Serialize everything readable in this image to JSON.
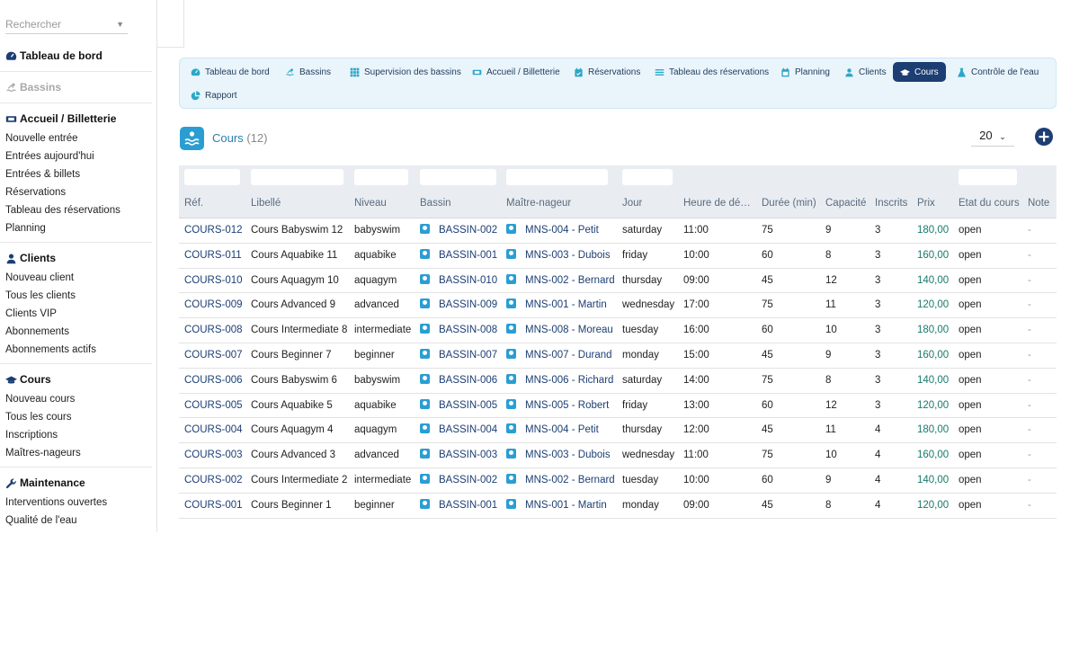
{
  "search": {
    "placeholder": "Rechercher"
  },
  "sidebar": {
    "sections": [
      {
        "title": "Tableau de bord",
        "icon": "dashboard-icon",
        "disabled": false,
        "items": []
      },
      {
        "title": "Bassins",
        "icon": "swimmer-icon",
        "disabled": true,
        "items": []
      },
      {
        "title": "Accueil / Billetterie",
        "icon": "ticket-icon",
        "disabled": false,
        "items": [
          "Nouvelle entrée",
          "Entrées aujourd'hui",
          "Entrées & billets",
          "Réservations",
          "Tableau des réservations",
          "Planning"
        ]
      },
      {
        "title": "Clients",
        "icon": "user-icon",
        "disabled": false,
        "items": [
          "Nouveau client",
          "Tous les clients",
          "Clients VIP",
          "Abonnements",
          "Abonnements actifs"
        ]
      },
      {
        "title": "Cours",
        "icon": "graduation-cap-icon",
        "disabled": false,
        "items": [
          "Nouveau cours",
          "Tous les cours",
          "Inscriptions",
          "Maîtres-nageurs"
        ]
      },
      {
        "title": "Maintenance",
        "icon": "wrench-icon",
        "disabled": false,
        "items": [
          "Interventions ouvertes",
          "Qualité de l'eau"
        ]
      }
    ]
  },
  "tabs": [
    {
      "label": "Tableau de bord",
      "icon": "dashboard-icon",
      "active": false
    },
    {
      "label": "Bassins",
      "icon": "swimmer-icon",
      "active": false
    },
    {
      "label": "Supervision des bassins",
      "icon": "grid-icon",
      "active": false
    },
    {
      "label": "Accueil / Billetterie",
      "icon": "ticket-icon",
      "active": false
    },
    {
      "label": "Réservations",
      "icon": "calendar-check-icon",
      "active": false
    },
    {
      "label": "Tableau des réservations",
      "icon": "list-icon",
      "active": false
    },
    {
      "label": "Planning",
      "icon": "calendar-icon",
      "active": false
    },
    {
      "label": "Clients",
      "icon": "user-icon",
      "active": false
    },
    {
      "label": "Cours",
      "icon": "graduation-cap-icon",
      "active": true
    },
    {
      "label": "Contrôle de l'eau",
      "icon": "flask-icon",
      "active": false
    },
    {
      "label": "Rapport",
      "icon": "pie-chart-icon",
      "active": false
    }
  ],
  "page": {
    "title": "Cours",
    "count": "(12)",
    "per_page": "20"
  },
  "table": {
    "columns": [
      "Réf.",
      "Libellé",
      "Niveau",
      "Bassin",
      "Maître-nageur",
      "Jour",
      "Heure de dé…",
      "Durée (min)",
      "Capacité",
      "Inscrits",
      "Prix",
      "État du cours",
      "Note"
    ],
    "rows": [
      [
        "COURS-012",
        "Cours Babyswim 12",
        "babyswim",
        "BASSIN-002",
        "MNS-004 - Petit",
        "saturday",
        "11:00",
        "75",
        "9",
        "3",
        "180,00",
        "open",
        "-"
      ],
      [
        "COURS-011",
        "Cours Aquabike 11",
        "aquabike",
        "BASSIN-001",
        "MNS-003 - Dubois",
        "friday",
        "10:00",
        "60",
        "8",
        "3",
        "160,00",
        "open",
        "-"
      ],
      [
        "COURS-010",
        "Cours Aquagym 10",
        "aquagym",
        "BASSIN-010",
        "MNS-002 - Bernard",
        "thursday",
        "09:00",
        "45",
        "12",
        "3",
        "140,00",
        "open",
        "-"
      ],
      [
        "COURS-009",
        "Cours Advanced 9",
        "advanced",
        "BASSIN-009",
        "MNS-001 - Martin",
        "wednesday",
        "17:00",
        "75",
        "11",
        "3",
        "120,00",
        "open",
        "-"
      ],
      [
        "COURS-008",
        "Cours Intermediate 8",
        "intermediate",
        "BASSIN-008",
        "MNS-008 - Moreau",
        "tuesday",
        "16:00",
        "60",
        "10",
        "3",
        "180,00",
        "open",
        "-"
      ],
      [
        "COURS-007",
        "Cours Beginner 7",
        "beginner",
        "BASSIN-007",
        "MNS-007 - Durand",
        "monday",
        "15:00",
        "45",
        "9",
        "3",
        "160,00",
        "open",
        "-"
      ],
      [
        "COURS-006",
        "Cours Babyswim 6",
        "babyswim",
        "BASSIN-006",
        "MNS-006 - Richard",
        "saturday",
        "14:00",
        "75",
        "8",
        "3",
        "140,00",
        "open",
        "-"
      ],
      [
        "COURS-005",
        "Cours Aquabike 5",
        "aquabike",
        "BASSIN-005",
        "MNS-005 - Robert",
        "friday",
        "13:00",
        "60",
        "12",
        "3",
        "120,00",
        "open",
        "-"
      ],
      [
        "COURS-004",
        "Cours Aquagym 4",
        "aquagym",
        "BASSIN-004",
        "MNS-004 - Petit",
        "thursday",
        "12:00",
        "45",
        "11",
        "4",
        "180,00",
        "open",
        "-"
      ],
      [
        "COURS-003",
        "Cours Advanced 3",
        "advanced",
        "BASSIN-003",
        "MNS-003 - Dubois",
        "wednesday",
        "11:00",
        "75",
        "10",
        "4",
        "160,00",
        "open",
        "-"
      ],
      [
        "COURS-002",
        "Cours Intermediate 2",
        "intermediate",
        "BASSIN-002",
        "MNS-002 - Bernard",
        "tuesday",
        "10:00",
        "60",
        "9",
        "4",
        "140,00",
        "open",
        "-"
      ],
      [
        "COURS-001",
        "Cours Beginner 1",
        "beginner",
        "BASSIN-001",
        "MNS-001 - Martin",
        "monday",
        "09:00",
        "45",
        "8",
        "4",
        "120,00",
        "open",
        "-"
      ]
    ]
  },
  "colors": {
    "accent": "#1c3e73",
    "primary": "#2a9ed3",
    "tabs_bg": "#eaf5fb",
    "price": "#1a7a6a"
  }
}
